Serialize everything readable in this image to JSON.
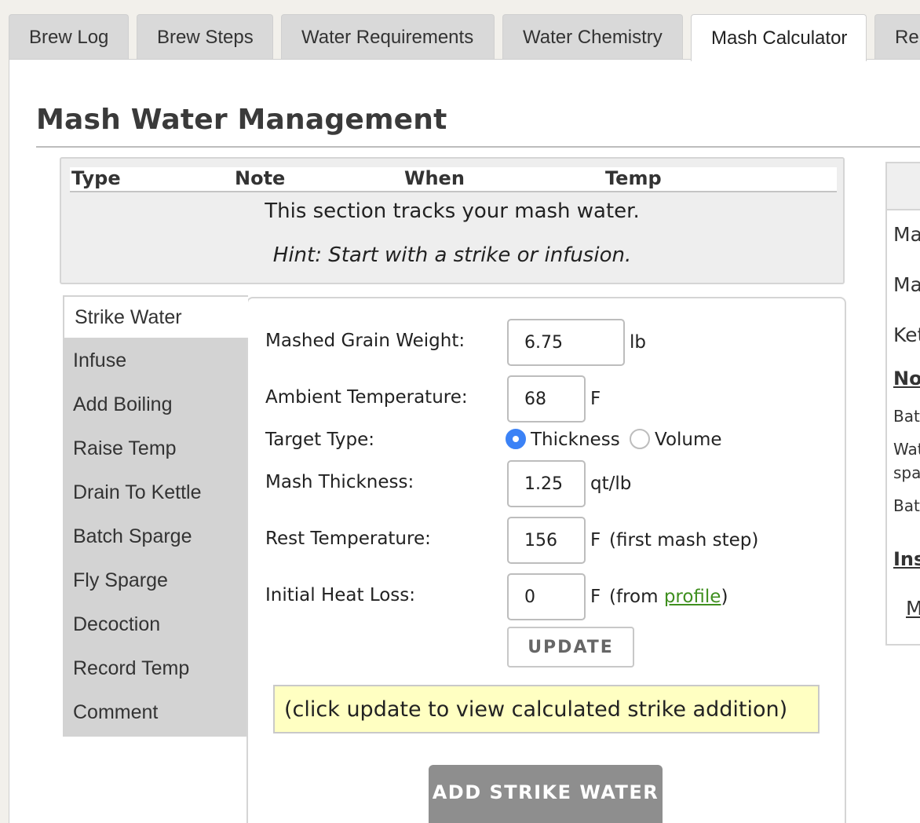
{
  "tabs": [
    {
      "label": "Brew Log"
    },
    {
      "label": "Brew Steps"
    },
    {
      "label": "Water Requirements"
    },
    {
      "label": "Water Chemistry"
    },
    {
      "label": "Mash Calculator",
      "active": true
    },
    {
      "label": "Re"
    }
  ],
  "page_title": "Mash Water Management",
  "mash_log": {
    "columns": [
      "Type",
      "Note",
      "When",
      "Temp"
    ],
    "empty_message": "This section tracks your mash water.",
    "hint": "Hint: Start with a strike or infusion."
  },
  "actions": [
    {
      "label": "Strike Water",
      "active": true
    },
    {
      "label": "Infuse"
    },
    {
      "label": "Add Boiling"
    },
    {
      "label": "Raise Temp"
    },
    {
      "label": "Drain To Kettle"
    },
    {
      "label": "Batch Sparge"
    },
    {
      "label": "Fly Sparge"
    },
    {
      "label": "Decoction"
    },
    {
      "label": "Record Temp"
    },
    {
      "label": "Comment"
    }
  ],
  "form": {
    "grain_weight": {
      "label": "Mashed Grain Weight:",
      "value": "6.75",
      "unit": "lb"
    },
    "ambient_temp": {
      "label": "Ambient Temperature:",
      "value": "68",
      "unit": "F"
    },
    "target_type": {
      "label": "Target Type:",
      "options": [
        "Thickness",
        "Volume"
      ],
      "selected": "Thickness"
    },
    "mash_thickness": {
      "label": "Mash Thickness:",
      "value": "1.25",
      "unit": "qt/lb"
    },
    "rest_temp": {
      "label": "Rest Temperature:",
      "value": "156",
      "unit": "F",
      "note": "(first mash step)"
    },
    "heat_loss": {
      "label": "Initial Heat Loss:",
      "value": "0",
      "unit": "F",
      "note_prefix": "(from ",
      "note_link": "profile",
      "note_suffix": ")"
    },
    "update_label": "UPDATE",
    "notice": "(click update to view calculated strike addition)",
    "add_label": "ADD STRIKE WATER"
  },
  "sidebar": {
    "rows": [
      "Ma",
      "Ma",
      "Ket"
    ],
    "notes_heading": "No",
    "note_lines": [
      "Bat",
      "Wat",
      "spa",
      "Bat"
    ],
    "ins_heading": "Ins",
    "link": "M"
  },
  "colors": {
    "accent_radio": "#3b82f6",
    "link": "#3f8f1f",
    "notice_bg": "#ffffc2",
    "add_button": "#8e8e8e"
  }
}
